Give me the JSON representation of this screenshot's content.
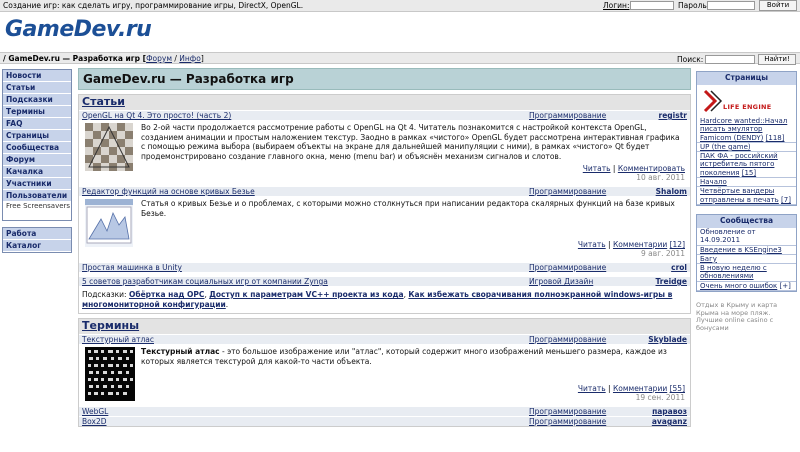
{
  "top": {
    "site_title": "Создание игр: как сделать игру, программирование игры, DirectX, OpenGL.",
    "login_label": "Логин:",
    "password_label": "Пароль:",
    "login_button": "Войти"
  },
  "logo": "GameDev.ru",
  "breadcrumb": {
    "prefix": "/ GameDev.ru — Разработка игр [",
    "forum": "Форум",
    "sep": " / ",
    "info": "Инфо",
    "suffix": "]"
  },
  "search": {
    "label": "Поиск:",
    "button": "Найти!"
  },
  "nav": {
    "group1": [
      "Новости",
      "Статьи",
      "Подсказки",
      "Термины",
      "FAQ",
      "Страницы",
      "Сообщества",
      "Форум",
      "Качалка",
      "Участники",
      "Пользователи",
      "Free Screensavers"
    ],
    "group2": [
      "Работа",
      "Каталог"
    ]
  },
  "main_header": "GameDev.ru — Разработка игр",
  "articles": {
    "title": "Статьи",
    "items": [
      {
        "title": "OpenGL на Qt 4. Это просто! (часть 2)",
        "category": "Программирование",
        "author": "registr",
        "desc": "Во 2-ой части продолжается рассмотрение работы с OpenGL на Qt 4. Читатель познакомится с настройкой контекста OpenGL, созданием анимации и простым наложением текстур. Заодно в рамках «чистого» OpenGL будет рассмотрена интерактивная графика с помощью режима выбора (выбираем объекты на экране для дальнейшей манипуляции с ними), в рамках «чистого» Qt будет продемонстрировано создание главного окна, меню (menu bar) и объяснён механизм сигналов и слотов.",
        "read": "Читать",
        "comments": "Комментировать",
        "date": "10 авг. 2011"
      },
      {
        "title": "Редактор функций на основе кривых Безье",
        "category": "Программирование",
        "author": "Shalom",
        "desc": "Статья о кривых Безье и о проблемах, с которыми можно столкнуться при написании редактора скалярных функций на базе кривых Безье.",
        "read": "Читать",
        "comments": "Комментарии",
        "count": "[12]",
        "date": "9 авг. 2011"
      }
    ],
    "rows": [
      {
        "title": "Простая машинка в Unity",
        "category": "Программирование",
        "author": "crol"
      },
      {
        "title": "5 советов разработчикам социальных игр от компании Zynga",
        "category": "Игровой Дизайн",
        "author": "Treidge"
      }
    ]
  },
  "hints": {
    "label": "Подсказки: ",
    "items": [
      "Обёртка над OPC",
      "Доступ к параметрам VC++ проекта из кода",
      "Как избежать сворачивания полноэкранной windows-игры в многомониторной конфигурации"
    ],
    "sep": ", ",
    "end": "."
  },
  "terms": {
    "title": "Термины",
    "item": {
      "title": "Текстурный атлас",
      "category": "Программирование",
      "author": "Skyblade",
      "bold": "Текстурный атлас",
      "desc": " - это большое изображение или \"атлас\", который содержит много изображений меньшего размера, каждое из которых является текстурой для какой-то части объекта.",
      "read": "Читать",
      "comments": "Комментарии",
      "count": "[55]",
      "date": "19 сен. 2011"
    },
    "rows": [
      {
        "title": "WebGL",
        "category": "Программирование",
        "author": "паравоз"
      },
      {
        "title": "Box2D",
        "category": "Программирование",
        "author": "avaganz"
      }
    ]
  },
  "right": {
    "pages": {
      "title": "Страницы",
      "logo_text": "LIFE ENGINE",
      "items": [
        "Hardcore wanted::Начал писать эмулятор Famicom (DENDY)",
        "[118]",
        "UP (the game)",
        "ПАК ФА - российский истребитель пятого поколения",
        "[15]",
        "Начало",
        "Четвёртые вандеры отправлены в печать",
        "[7]"
      ]
    },
    "communities": {
      "title": "Сообщества",
      "items": [
        "Обновление от 14.09.2011",
        "Введение в KSEngine3",
        "Багу",
        "В новую неделю с обновлениями",
        "Очень много ошибок",
        "[+]"
      ]
    },
    "ad": "Отдых в Крыму и карта Крыма на море пляж. Лучшие online casino с бонусами"
  },
  "colors": {
    "accent": "#1c4f96",
    "nav_bg": "#c7d3ea",
    "header_bg": "#b9d2d6"
  }
}
